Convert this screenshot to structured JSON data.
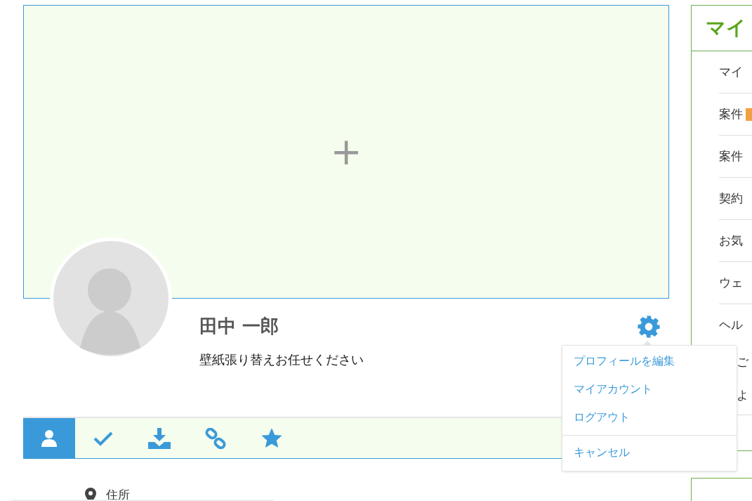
{
  "cover": {
    "add_icon": "+"
  },
  "profile": {
    "name": "田中 一郎",
    "tagline": "壁紙張り替えお任せください"
  },
  "settings_menu": {
    "expanded": true,
    "items": [
      {
        "label": "プロフィールを編集",
        "kind": "item"
      },
      {
        "label": "マイアカウント",
        "kind": "item"
      },
      {
        "label": "ログアウト",
        "kind": "item"
      },
      {
        "label": "キャンセル",
        "kind": "cancel"
      }
    ]
  },
  "tabs": [
    {
      "selected": true
    },
    {
      "selected": false
    },
    {
      "selected": false
    },
    {
      "selected": false
    },
    {
      "selected": false
    }
  ],
  "details": [
    {
      "label": "住所"
    }
  ],
  "sidebar": {
    "title": "マイ",
    "items": [
      {
        "label": "マイ",
        "badge": false
      },
      {
        "label": "案件",
        "badge": true
      },
      {
        "label": "案件",
        "badge": false
      },
      {
        "label": "契約",
        "badge": false
      },
      {
        "label": "お気",
        "badge": false
      },
      {
        "label": "ウェ",
        "badge": false
      },
      {
        "label": "ヘル",
        "badge": false,
        "children": [
          {
            "label": "ご"
          },
          {
            "label": "よ"
          }
        ]
      }
    ]
  }
}
